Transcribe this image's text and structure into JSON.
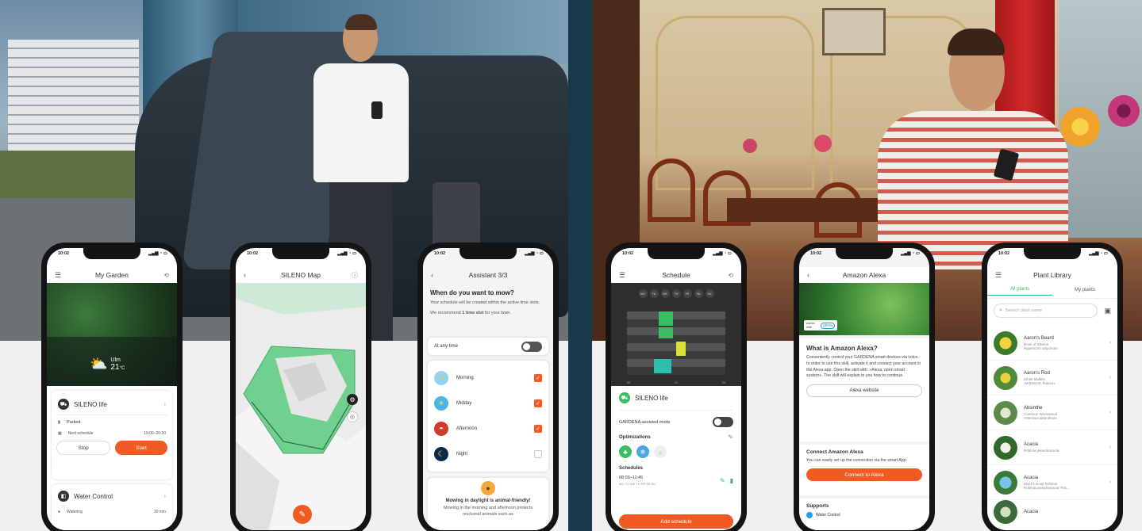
{
  "colors": {
    "accent": "#f15a22",
    "green": "#3cb878",
    "dark": "#2f2f2f"
  },
  "phones": {
    "garden": {
      "time": "10:02",
      "title": "My Garden",
      "menu_icon": "menu-icon",
      "history_icon": "history-icon",
      "weather": {
        "city": "Ulm",
        "temp": "21",
        "unit": "°C"
      },
      "mower": {
        "name": "SILENO life",
        "status": "Parked",
        "next_label": "Next schedule",
        "next_value": "19:00–20:30",
        "stop": "Stop",
        "start": "Start"
      },
      "water": {
        "name": "Water Control",
        "status": "Watering",
        "value": "30 min"
      }
    },
    "map": {
      "time": "10:02",
      "title": "SILENO Map"
    },
    "assistant": {
      "time": "10:02",
      "title": "Assistant 3/3",
      "question": "When do you want to mow?",
      "desc": "Your schedule will be created within the active time slots.",
      "recommend_pre": "We recommend",
      "recommend_bold": "1 time slot",
      "recommend_post": "for your lawn.",
      "any_time": "At any time",
      "slots": [
        {
          "label": "Morning",
          "checked": true
        },
        {
          "label": "Midday",
          "checked": true
        },
        {
          "label": "Afternoon",
          "checked": true
        },
        {
          "label": "Night",
          "checked": false
        }
      ],
      "tip_title": "Mowing in daylight is animal-friendly!",
      "tip_text": "Mowing in the morning and afternoon protects nocturnal animals such as"
    },
    "schedule": {
      "time": "10:02",
      "title": "Schedule",
      "days": [
        "MO",
        "TU",
        "WE",
        "TH",
        "FR",
        "SA",
        "SU"
      ],
      "axis": [
        "00",
        "12",
        "24"
      ],
      "device": "SILENO life",
      "assisted": "GARDENA-assisted mode",
      "optimizations": "Optimizations",
      "schedules": "Schedules",
      "slot_time": "08:00–11:45",
      "slot_days": "MO TU WE TH FR SA SU",
      "add": "Add schedule"
    },
    "alexa": {
      "time": "10:02",
      "title": "Amazon Alexa",
      "badge_works": "works with",
      "badge_brand": "alexa",
      "heading": "What is Amazon Alexa?",
      "body": "Conveniently control your GARDENA smart devices via voice. In order to use this skill, activate it and connect your account in the Alexa app. Open the skill with: »Alexa, open smart system«. The skill will explain to you how to continue.",
      "website": "Alexa website",
      "connect_heading": "Connect Amazon Alexa",
      "connect_body": "You can easily set up the connection via the smart App.",
      "connect_btn": "Connect to Alexa",
      "supports": "Supports",
      "supports_item": "Water Control"
    },
    "plants": {
      "time": "10:02",
      "title": "Plant Library",
      "tab_all": "All plants",
      "tab_mine": "My plants",
      "search": "Search plant name",
      "items": [
        {
          "name": "Aaron's Beard",
          "sub1": "Rose of Sharon",
          "sub2": "Hypericum calycinum"
        },
        {
          "name": "Aaron's Rod",
          "sub1": "White Mullein",
          "sub2": "Verbascum thapsus"
        },
        {
          "name": "Absinthe",
          "sub1": "Common Wormwood",
          "sub2": "Artemisia absinthium"
        },
        {
          "name": "Acacia",
          "sub1": "Robinia pseudoacacia",
          "sub2": ""
        },
        {
          "name": "Acacia",
          "sub1": "Black Locust Robinia",
          "sub2": "Robinia pseudoacacia 'Fris..."
        },
        {
          "name": "Acacia",
          "sub1": "",
          "sub2": ""
        }
      ]
    }
  }
}
